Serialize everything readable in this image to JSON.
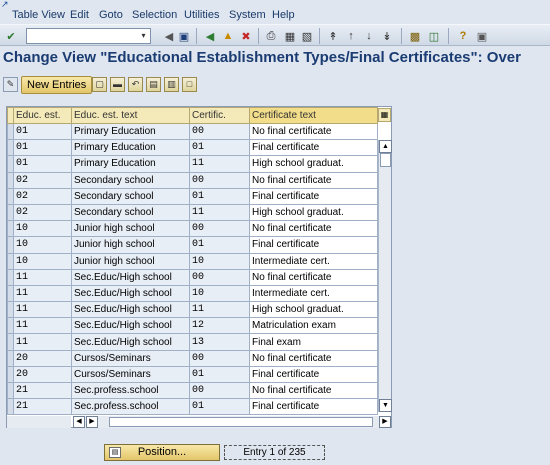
{
  "menu": {
    "items": [
      "Table View",
      "Edit",
      "Goto",
      "Selection",
      "Utilities",
      "System",
      "Help"
    ]
  },
  "toolbar": {
    "command_value": "",
    "icons": [
      "enter-icon",
      "save-icon",
      "back-icon",
      "exit-icon",
      "cancel-icon",
      "print-icon",
      "find-icon",
      "find-next-icon",
      "first-page-icon",
      "previous-page-icon",
      "next-page-icon",
      "last-page-icon",
      "create-session-icon",
      "shortcut-icon",
      "help-icon",
      "layout-icon"
    ]
  },
  "title": "Change View \"Educational Establishment Types/Final Certificates\": Over",
  "app_toolbar": {
    "new_entries_label": "New Entries"
  },
  "table": {
    "columns": [
      "Educ. est.",
      "Educ. est. text",
      "Certific.",
      "Certificate text"
    ],
    "rows": [
      [
        "01",
        "Primary Education",
        "00",
        "No final certificate"
      ],
      [
        "01",
        "Primary Education",
        "01",
        "Final certificate"
      ],
      [
        "01",
        "Primary Education",
        "11",
        "High school graduat."
      ],
      [
        "02",
        "Secondary school",
        "00",
        "No final certificate"
      ],
      [
        "02",
        "Secondary school",
        "01",
        "Final certificate"
      ],
      [
        "02",
        "Secondary school",
        "11",
        "High school graduat."
      ],
      [
        "10",
        "Junior high school",
        "00",
        "No final certificate"
      ],
      [
        "10",
        "Junior high school",
        "01",
        "Final certificate"
      ],
      [
        "10",
        "Junior high school",
        "10",
        "Intermediate cert."
      ],
      [
        "11",
        "Sec.Educ/High school",
        "00",
        "No final certificate"
      ],
      [
        "11",
        "Sec.Educ/High school",
        "10",
        "Intermediate cert."
      ],
      [
        "11",
        "Sec.Educ/High school",
        "11",
        "High school graduat."
      ],
      [
        "11",
        "Sec.Educ/High school",
        "12",
        "Matriculation exam"
      ],
      [
        "11",
        "Sec.Educ/High school",
        "13",
        "Final exam"
      ],
      [
        "20",
        "Cursos/Seminars",
        "00",
        "No final certificate"
      ],
      [
        "20",
        "Cursos/Seminars",
        "01",
        "Final certificate"
      ],
      [
        "21",
        "Sec.profess.school",
        "00",
        "No final certificate"
      ],
      [
        "21",
        "Sec.profess.school",
        "01",
        "Final certificate"
      ]
    ]
  },
  "footer": {
    "position_label": "Position...",
    "entry_text": "Entry 1 of 235"
  },
  "colors": {
    "title": "#1b3c73",
    "header_bg": "#f4e9b8",
    "button_bg": "#e3c66a"
  }
}
